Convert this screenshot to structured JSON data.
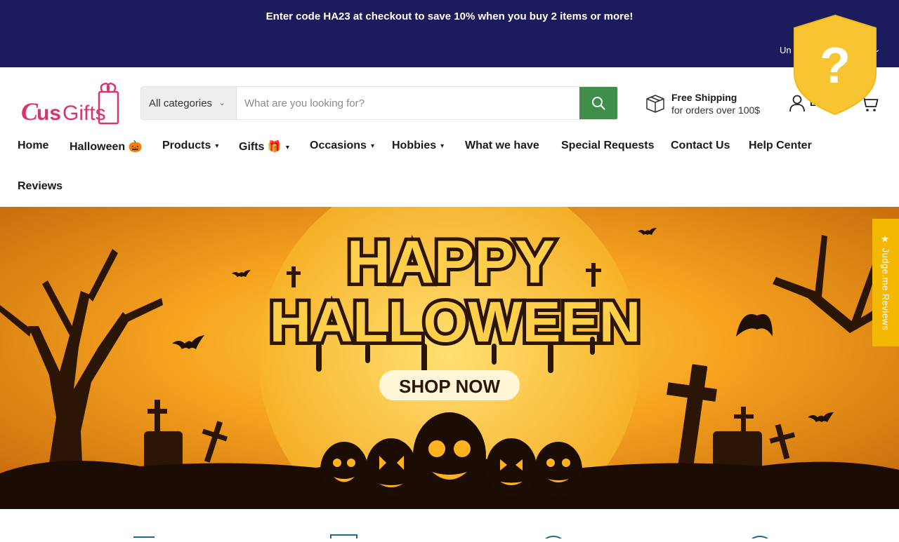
{
  "announcement": {
    "message": "Enter code HA23 at checkout to save 10% when you buy 2 items or more!",
    "locale_label": "Un"
  },
  "header": {
    "logo_text": "CusGifts",
    "search": {
      "category_label": "All categories",
      "placeholder": "What are you looking for?"
    },
    "shipping": {
      "title": "Free Shipping",
      "subtitle": "for orders over 100$"
    },
    "account_label": "L"
  },
  "nav": {
    "items": [
      {
        "label": "Home"
      },
      {
        "label": "Halloween 🎃"
      },
      {
        "label": "Products"
      },
      {
        "label": "Gifts 🎁"
      },
      {
        "label": "Occasions"
      },
      {
        "label": "Hobbies"
      },
      {
        "label": "What we have"
      },
      {
        "label": "Special Requests"
      },
      {
        "label": "Contact Us"
      },
      {
        "label": "Help Center"
      },
      {
        "label": "Reviews"
      }
    ]
  },
  "hero": {
    "line1": "HAPPY",
    "line2": "HALLOWEEN",
    "cta": "SHOP NOW"
  },
  "reviews_tab": {
    "label": "★ Judge.me Reviews"
  },
  "colors": {
    "announce_bg": "#1c1b5c",
    "search_button": "#3f8f4a",
    "reviews_tab": "#f5b800",
    "badge": "#f7c531"
  }
}
